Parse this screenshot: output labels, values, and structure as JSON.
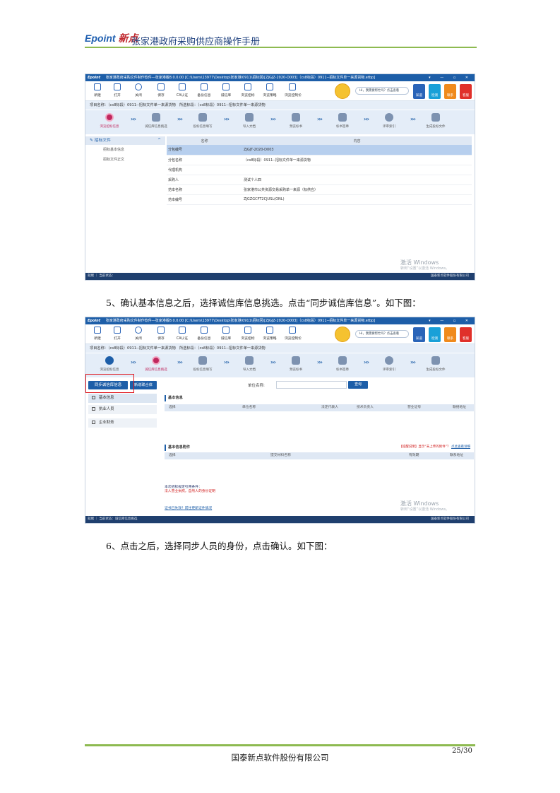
{
  "header": {
    "logo_en": "Epoint",
    "logo_cn": "新点",
    "title": "张家港政府采购供应商操作手册"
  },
  "screenshot1": {
    "window_title": "张家港政府采购文件制作软件—张家港版8.0.0.00  [C:\\Users\\13977\\Desktop\\张家港\\0911\\招标回\\[ZJGJZ-2020-D003]（cs8标段）0911--招标文件单一来源货物.etbp]",
    "app": "Epoint",
    "window_controls": "▾ — ▫ ✕",
    "toolbar": [
      "新建",
      "打开",
      "关闭",
      "保存",
      "CA认证",
      "备份信息",
      "诚信库",
      "浏览招标",
      "浏览策略",
      "浏览控制价"
    ],
    "bubble": "Hi，我需要帮忙吗？点击查看",
    "right_buttons": [
      "知道",
      "检测",
      "联系",
      "客服"
    ],
    "project": "项目名称：（cs8标段）0911--招标文件单一来源货物　所选标段：（cs8标段）0911--招标文件单一来源货物",
    "steps": [
      "浏览招标信息",
      "诚信库信息挑选",
      "投标信息填写",
      "导入文档",
      "预览标书",
      "标书签章",
      "评审索引",
      "生成投标文件"
    ],
    "sidebar_title": "招标文件",
    "sidebar_items": [
      "招标基本信息",
      "招标文件正文"
    ],
    "table_head": [
      "名称",
      "内容"
    ],
    "table_rows": [
      [
        "分包编号",
        "ZJGJT-2020-D003"
      ],
      [
        "分包名称",
        "（cs8标段）0911--招标文件单一来源货物"
      ],
      [
        "代理机构",
        ""
      ],
      [
        "采购人",
        "测试个人四"
      ],
      [
        "范本名称",
        "张家港市公共资源交易采购单一来源（标供应）"
      ],
      [
        "范本编号",
        "ZJGZGCFT2CJUSL(ONL)"
      ]
    ],
    "status": "就绪 ｜ 当前状态：",
    "status_right": "国泰新点软件股份有限公司",
    "watermark": "激活 Windows",
    "watermark_sub": "转到“设置”以激活 Windows。"
  },
  "paragraph1": "5、确认基本信息之后，选择诚信库信息挑选。点击“同步诚信库信息”。如下图：",
  "screenshot2": {
    "btn_sync": "同步诚信库信息",
    "btn_new": "新增联合体",
    "unit_label": "单位名称:",
    "query": "查询",
    "nav": [
      "基本信息",
      "执业人员",
      "企业财务"
    ],
    "section1": "基本信息",
    "cols1": [
      "选择",
      "单位名称",
      "法定代表人",
      "技术负责人",
      "营业证号",
      "联络地址"
    ],
    "section2": "基本信息附件",
    "cols2": [
      "选择",
      "提交材料名称",
      "有效期",
      "联系地址"
    ],
    "hint": "【提醒说明】显示“未上传的附件”？",
    "hint_link": "点此查看详细",
    "req_title": "本次招标规定引用条件：",
    "req_text": "法人营业执照，自然人的身份证明",
    "link": "证书已失效？前往更新证件情况",
    "status": "就绪 ｜ 当前状态：诚信库信息挑选",
    "status_right": "国泰新点软件股份有限公司",
    "watermark": "激活 Windows",
    "watermark_sub": "转到“设置”以激活 Windows。"
  },
  "paragraph2": "6、点击之后，选择同步人员的身份，点击确认。如下图：",
  "page_number": "25/30",
  "footer": "国泰新点软件股份有限公司"
}
